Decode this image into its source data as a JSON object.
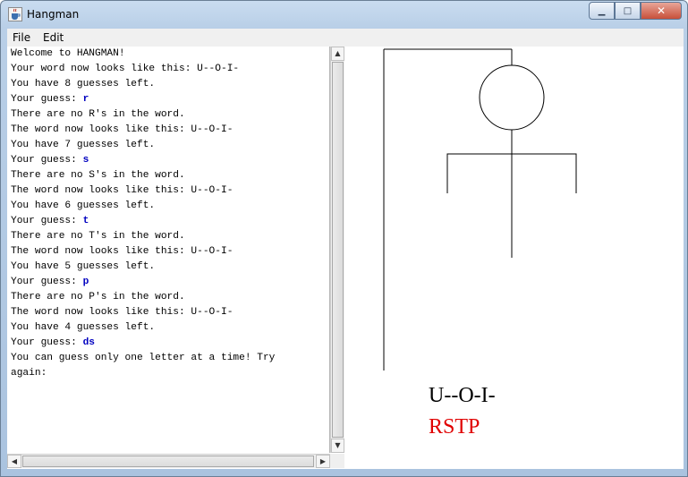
{
  "window": {
    "title": "Hangman",
    "icon": "java-cup-icon"
  },
  "window_buttons": {
    "minimize": "▁",
    "maximize": "□",
    "close": "✕"
  },
  "menu": {
    "file": "File",
    "edit": "Edit"
  },
  "console": {
    "lines": [
      {
        "text": "Welcome to HANGMAN!",
        "type": "output"
      },
      {
        "text": "Your word now looks like this: U--O-I-",
        "type": "output"
      },
      {
        "text": "You have 8 guesses left.",
        "type": "output"
      },
      {
        "text": "Your guess: ",
        "type": "output",
        "guess": "r"
      },
      {
        "text": "There are no R's in the word.",
        "type": "output"
      },
      {
        "text": "The word now looks like this: U--O-I-",
        "type": "output"
      },
      {
        "text": "You have 7 guesses left.",
        "type": "output"
      },
      {
        "text": "Your guess: ",
        "type": "output",
        "guess": "s"
      },
      {
        "text": "There are no S's in the word.",
        "type": "output"
      },
      {
        "text": "The word now looks like this: U--O-I-",
        "type": "output"
      },
      {
        "text": "You have 6 guesses left.",
        "type": "output"
      },
      {
        "text": "Your guess: ",
        "type": "output",
        "guess": "t"
      },
      {
        "text": "There are no T's in the word.",
        "type": "output"
      },
      {
        "text": "The word now looks like this: U--O-I-",
        "type": "output"
      },
      {
        "text": "You have 5 guesses left.",
        "type": "output"
      },
      {
        "text": "Your guess: ",
        "type": "output",
        "guess": "p"
      },
      {
        "text": "There are no P's in the word.",
        "type": "output"
      },
      {
        "text": "The word now looks like this: U--O-I-",
        "type": "output"
      },
      {
        "text": "You have 4 guesses left.",
        "type": "output"
      },
      {
        "text": "Your guess: ",
        "type": "output",
        "guess": "ds"
      },
      {
        "text": "You can guess only one letter at a time! Try",
        "type": "output"
      },
      {
        "text": "again:",
        "type": "output"
      }
    ]
  },
  "scrollbars": {
    "up": "▲",
    "down": "▼",
    "left": "◀",
    "right": "▶"
  },
  "gallows": {
    "word": "U--O-I-",
    "incorrect_letters": "RSTP",
    "incorrect_color": "#e00000",
    "body_parts_drawn": [
      "head",
      "body",
      "left-arm",
      "right-arm"
    ]
  }
}
